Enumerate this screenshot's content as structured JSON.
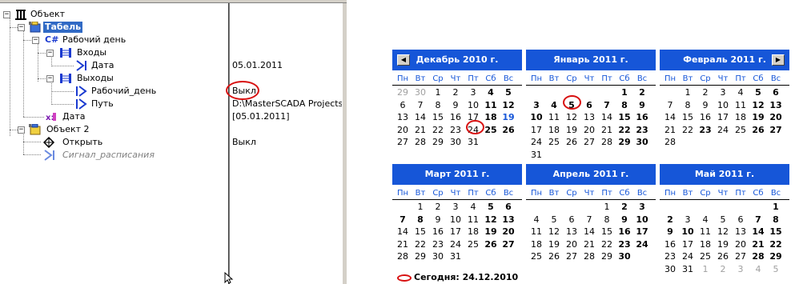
{
  "tree": {
    "items": [
      {
        "label": "Объект"
      },
      {
        "label": "Табель"
      },
      {
        "label": "Рабочий день"
      },
      {
        "label": "Входы"
      },
      {
        "label": "Дата"
      },
      {
        "label": "Выходы"
      },
      {
        "label": "Рабочий_день"
      },
      {
        "label": "Путь"
      },
      {
        "label": "Дата"
      },
      {
        "label": "Объект 2"
      },
      {
        "label": "Открыть"
      },
      {
        "label": "Сигнал_расписания"
      }
    ],
    "values": {
      "date_in": "05.01.2011",
      "workday_out": "Выкл",
      "path_out": "D:\\MasterSCADA Projects\\P",
      "date": "[05.01.2011]",
      "open": "Выкл"
    }
  },
  "calendar": {
    "dow": [
      "Пн",
      "Вт",
      "Ср",
      "Чт",
      "Пт",
      "Сб",
      "Вс"
    ],
    "months": [
      {
        "title": "Декабрь 2010 г."
      },
      {
        "title": "Январь 2011 г."
      },
      {
        "title": "Февраль 2011 г."
      },
      {
        "title": "Март 2011 г."
      },
      {
        "title": "Апрель 2011 г."
      },
      {
        "title": "Май 2011 г."
      }
    ],
    "today_label": "Сегодня: 24.12.2010"
  },
  "colors": {
    "accent": "#1656d8",
    "selection": "#316ac5",
    "highlight_circle": "#d81010"
  }
}
